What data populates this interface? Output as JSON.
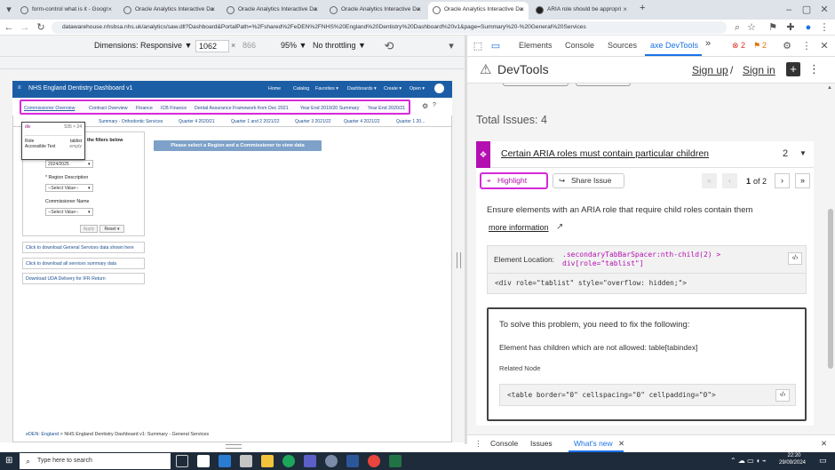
{
  "browser": {
    "tabs": [
      {
        "title": "form-control what is it - Googl"
      },
      {
        "title": "Oracle Analytics Interactive Da"
      },
      {
        "title": "Oracle Analytics Interactive Da"
      },
      {
        "title": "Oracle Analytics Interactive Da"
      },
      {
        "title": "Oracle Analytics Interactive Da"
      },
      {
        "title": "ARIA role should be appropri"
      }
    ],
    "new_tab": "+",
    "url": "datawarehouse.nhsbsa.nhs.uk/analytics/saw.dll?Dashboard&PortalPath=%2Fshared%2FeDEN%2FNHS%20England%20Dentistry%20Dashboard%20v1&page=Summary%20-%20General%20Services"
  },
  "device_toolbar": {
    "dimensions_label": "Dimensions: Responsive ▼",
    "width": "1062",
    "times": "×",
    "height": "866",
    "zoom": "95% ▼",
    "throttle": "No throttling ▼"
  },
  "obi": {
    "title": "NHS England Dentistry Dashboard v1",
    "nav": [
      "Home",
      "Catalog",
      "Favorites ▾",
      "Dashboards ▾",
      "Create ▾",
      "Open ▾"
    ],
    "content_tabs": [
      "Commissioner Overview",
      "Contract Overview",
      "Finance",
      "ICB Finance",
      "Dental Assurance Framework from Dec 2021",
      "Year End 2019/20 Summary",
      "Year End 2020/21"
    ],
    "sub_tabs": [
      "Summary - Orthodontic Services",
      "Quarter 4 2020/21",
      "Quarter 1 and 2 2021/22",
      "Quarter 3 2021/22",
      "Quarter 4 2021/22",
      "Quarter 1 20..."
    ],
    "filters": {
      "heading": "the filters below",
      "year_value": "2024/2025",
      "region_label": "* Region Description",
      "region_value": "--Select Value--",
      "commissioner_label": "Commissioner Name",
      "commissioner_value": "--Select Value--",
      "apply": "Apply",
      "reset": "Reset ▾"
    },
    "downloads": [
      "Click to download General Services data shown here",
      "Click to download all services summary data",
      "Download UDA Delivery for IFR Return"
    ],
    "message": "Please select a Region and a Commissioner to view data",
    "breadcrumb": {
      "root": "eDEN: England",
      "sep": ">",
      "page": "NHS England Dentistry Dashboard v1: Summary - General Services"
    }
  },
  "tooltip": {
    "tag": "div",
    "size": "535 × 24",
    "role_label": "Role",
    "role_value": "tablist",
    "acc_label": "Accessible Text",
    "acc_value": "empty"
  },
  "devtools": {
    "tabs": [
      "Elements",
      "Console",
      "Sources",
      "axe DevTools"
    ],
    "more": "»",
    "errors": "2",
    "warnings": "2",
    "axe_title": "DevTools",
    "sign_up": "Sign up",
    "slash": "/",
    "sign_in": "Sign in",
    "total_issues": "Total Issues: 4",
    "issue_title": "Certain ARIA roles must contain particular children",
    "issue_count": "2",
    "highlight": "Highlight",
    "share": "Share Issue",
    "page_current": "1",
    "page_of": "of 2",
    "description": "Ensure elements with an ARIA role that require child roles contain them",
    "more_info": "more information",
    "location_label": "Element Location:",
    "location_value": ".secondaryTabBarSpacer:nth-child(2) > div[role=\"tablist\"]",
    "element_code": "<div role=\"tablist\" style=\"overflow: hidden;\">",
    "solve_title": "To solve this problem, you need to fix the following:",
    "solve_detail": "Element has children which are not allowed: table[tabindex]",
    "related_label": "Related Node",
    "related_code": "<table border=\"0\" cellspacing=\"0\" cellpadding=\"0\">",
    "drawer_tabs": [
      "Console",
      "Issues",
      "What's new"
    ]
  },
  "taskbar": {
    "search_placeholder": "Type here to search",
    "time": "22:20",
    "date": "29/09/2024"
  },
  "colors": {
    "accent": "#1a73e8",
    "axe_purple": "#b40fb0",
    "highlight": "#d62ad9",
    "obi_blue": "#1c5ea6"
  }
}
